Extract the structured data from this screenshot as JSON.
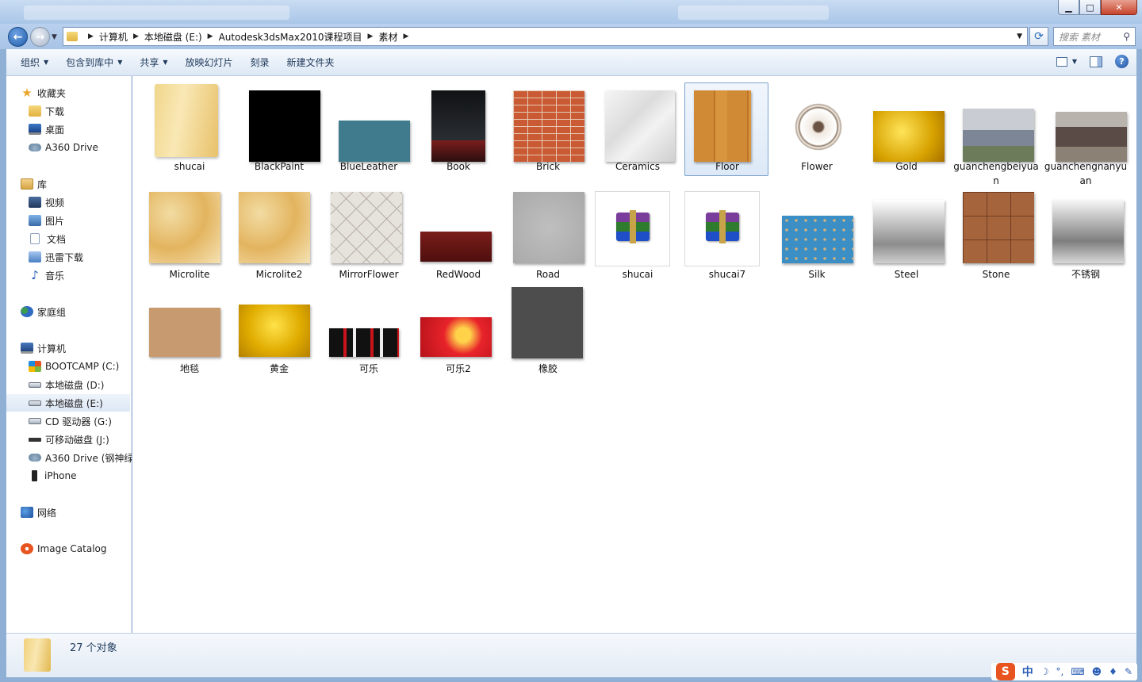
{
  "window": {
    "controls": [
      "minimize",
      "maximize",
      "close"
    ]
  },
  "address": {
    "crumbs": [
      "计算机",
      "本地磁盘 (E:)",
      "Autodesk3dsMax2010课程项目",
      "素材"
    ]
  },
  "search": {
    "placeholder": "搜索 素材"
  },
  "toolbar": {
    "organize": "组织",
    "include_library": "包含到库中",
    "share": "共享",
    "slideshow": "放映幻灯片",
    "burn": "刻录",
    "new_folder": "新建文件夹"
  },
  "sidebar": {
    "favorites": "收藏夹",
    "downloads": "下载",
    "desktop": "桌面",
    "a360": "A360 Drive",
    "libraries": "库",
    "videos": "视频",
    "pictures": "图片",
    "documents": "文档",
    "xunlei": "迅雷下载",
    "music": "音乐",
    "homegroup": "家庭组",
    "computer": "计算机",
    "bootcamp": "BOOTCAMP (C:)",
    "drive_d": "本地磁盘 (D:)",
    "drive_e": "本地磁盘 (E:)",
    "drive_g": "CD 驱动器 (G:)",
    "drive_j": "可移动磁盘 (J:)",
    "a360_2": "A360 Drive (钢神绿",
    "iphone": "iPhone",
    "network": "网络",
    "image_catalog": "Image Catalog"
  },
  "files": [
    {
      "name": "shucai",
      "thumb": "folder",
      "selected": false
    },
    {
      "name": "BlackPaint",
      "thumb": "black",
      "selected": false
    },
    {
      "name": "BlueLeather",
      "thumb": "blueleather",
      "selected": false
    },
    {
      "name": "Book",
      "thumb": "book",
      "selected": false
    },
    {
      "name": "Brick",
      "thumb": "brick",
      "selected": false
    },
    {
      "name": "Ceramics",
      "thumb": "ceramics",
      "selected": false
    },
    {
      "name": "Floor",
      "thumb": "floor",
      "selected": true
    },
    {
      "name": "Flower",
      "thumb": "flower",
      "selected": false
    },
    {
      "name": "Gold",
      "thumb": "gold",
      "selected": false
    },
    {
      "name": "guanchengbeiyuan",
      "thumb": "photo1",
      "selected": false
    },
    {
      "name": "guanchengnanyuan",
      "thumb": "photo2",
      "selected": false
    },
    {
      "name": "Microlite",
      "thumb": "microlite",
      "selected": false
    },
    {
      "name": "Microlite2",
      "thumb": "microlite",
      "selected": false
    },
    {
      "name": "MirrorFlower",
      "thumb": "mirrorflower",
      "selected": false
    },
    {
      "name": "RedWood",
      "thumb": "redwood",
      "selected": false
    },
    {
      "name": "Road",
      "thumb": "road",
      "selected": false
    },
    {
      "name": "shucai",
      "thumb": "rar",
      "selected": false
    },
    {
      "name": "shucai7",
      "thumb": "rar",
      "selected": false
    },
    {
      "name": "Silk",
      "thumb": "silk",
      "selected": false
    },
    {
      "name": "Steel",
      "thumb": "steel",
      "selected": false
    },
    {
      "name": "Stone",
      "thumb": "stone",
      "selected": false
    },
    {
      "name": "不锈钢",
      "thumb": "steel2",
      "selected": false
    },
    {
      "name": "地毯",
      "thumb": "carpet",
      "selected": false
    },
    {
      "name": "黄金",
      "thumb": "gold2",
      "selected": false
    },
    {
      "name": "可乐",
      "thumb": "cola",
      "selected": false
    },
    {
      "name": "可乐2",
      "thumb": "cola2",
      "selected": false
    },
    {
      "name": "橡胶",
      "thumb": "rubber",
      "selected": false
    }
  ],
  "status": {
    "count_text": "27 个对象"
  },
  "ime": {
    "logo": "S",
    "mode": "中"
  }
}
